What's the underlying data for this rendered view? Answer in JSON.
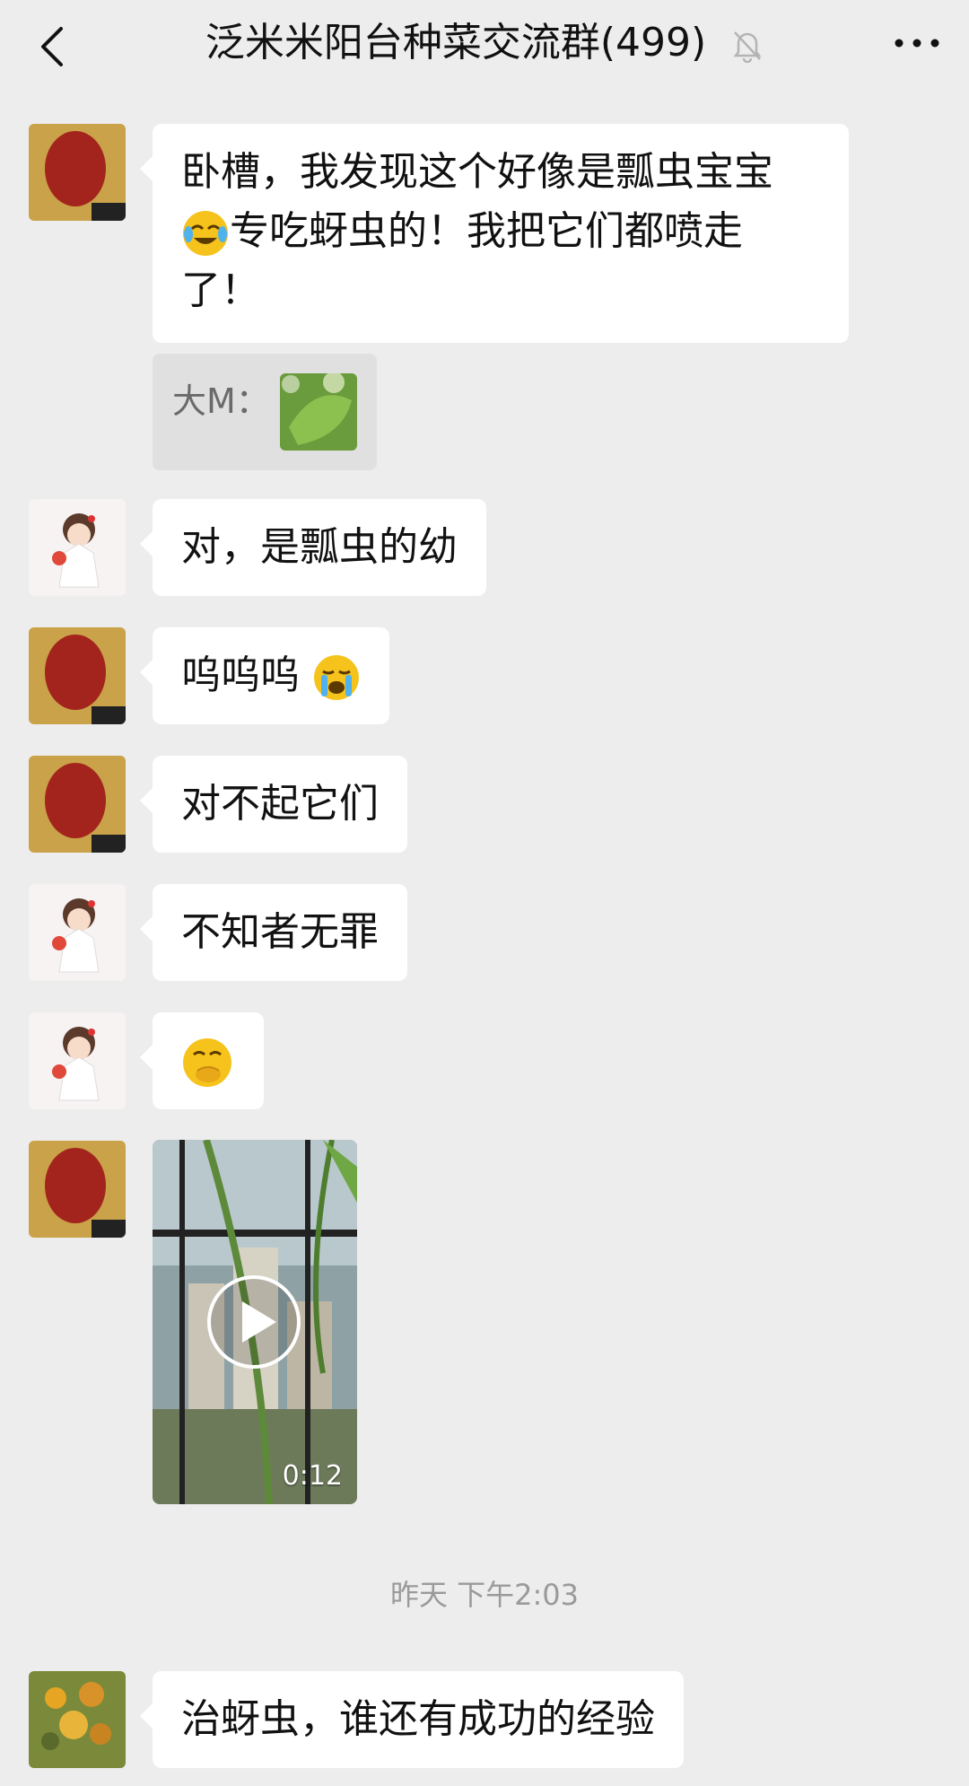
{
  "header": {
    "title": "泛米米阳台种菜交流群(499)"
  },
  "messages": [
    {
      "text": "卧槽，我发现这个好像是瓢虫宝宝",
      "text2": "专吃蚜虫的！我把它们都喷走了！",
      "emoji": "face-with-tears-of-joy"
    },
    {
      "quote_name": "大M："
    },
    {
      "text": "对，是瓢虫的幼"
    },
    {
      "text": "呜呜呜",
      "emoji": "loudly-crying-face"
    },
    {
      "text": "对不起它们"
    },
    {
      "text": "不知者无罪"
    },
    {
      "emoji": "face-with-hand-over-mouth"
    },
    {
      "video_duration": "0:12"
    },
    {
      "timestamp": "昨天 下午2:03"
    },
    {
      "text": "治蚜虫，谁还有成功的经验"
    }
  ],
  "colors": {
    "background": "#ededed",
    "bubble": "#ffffff",
    "timestamp": "#9a9a9a"
  }
}
